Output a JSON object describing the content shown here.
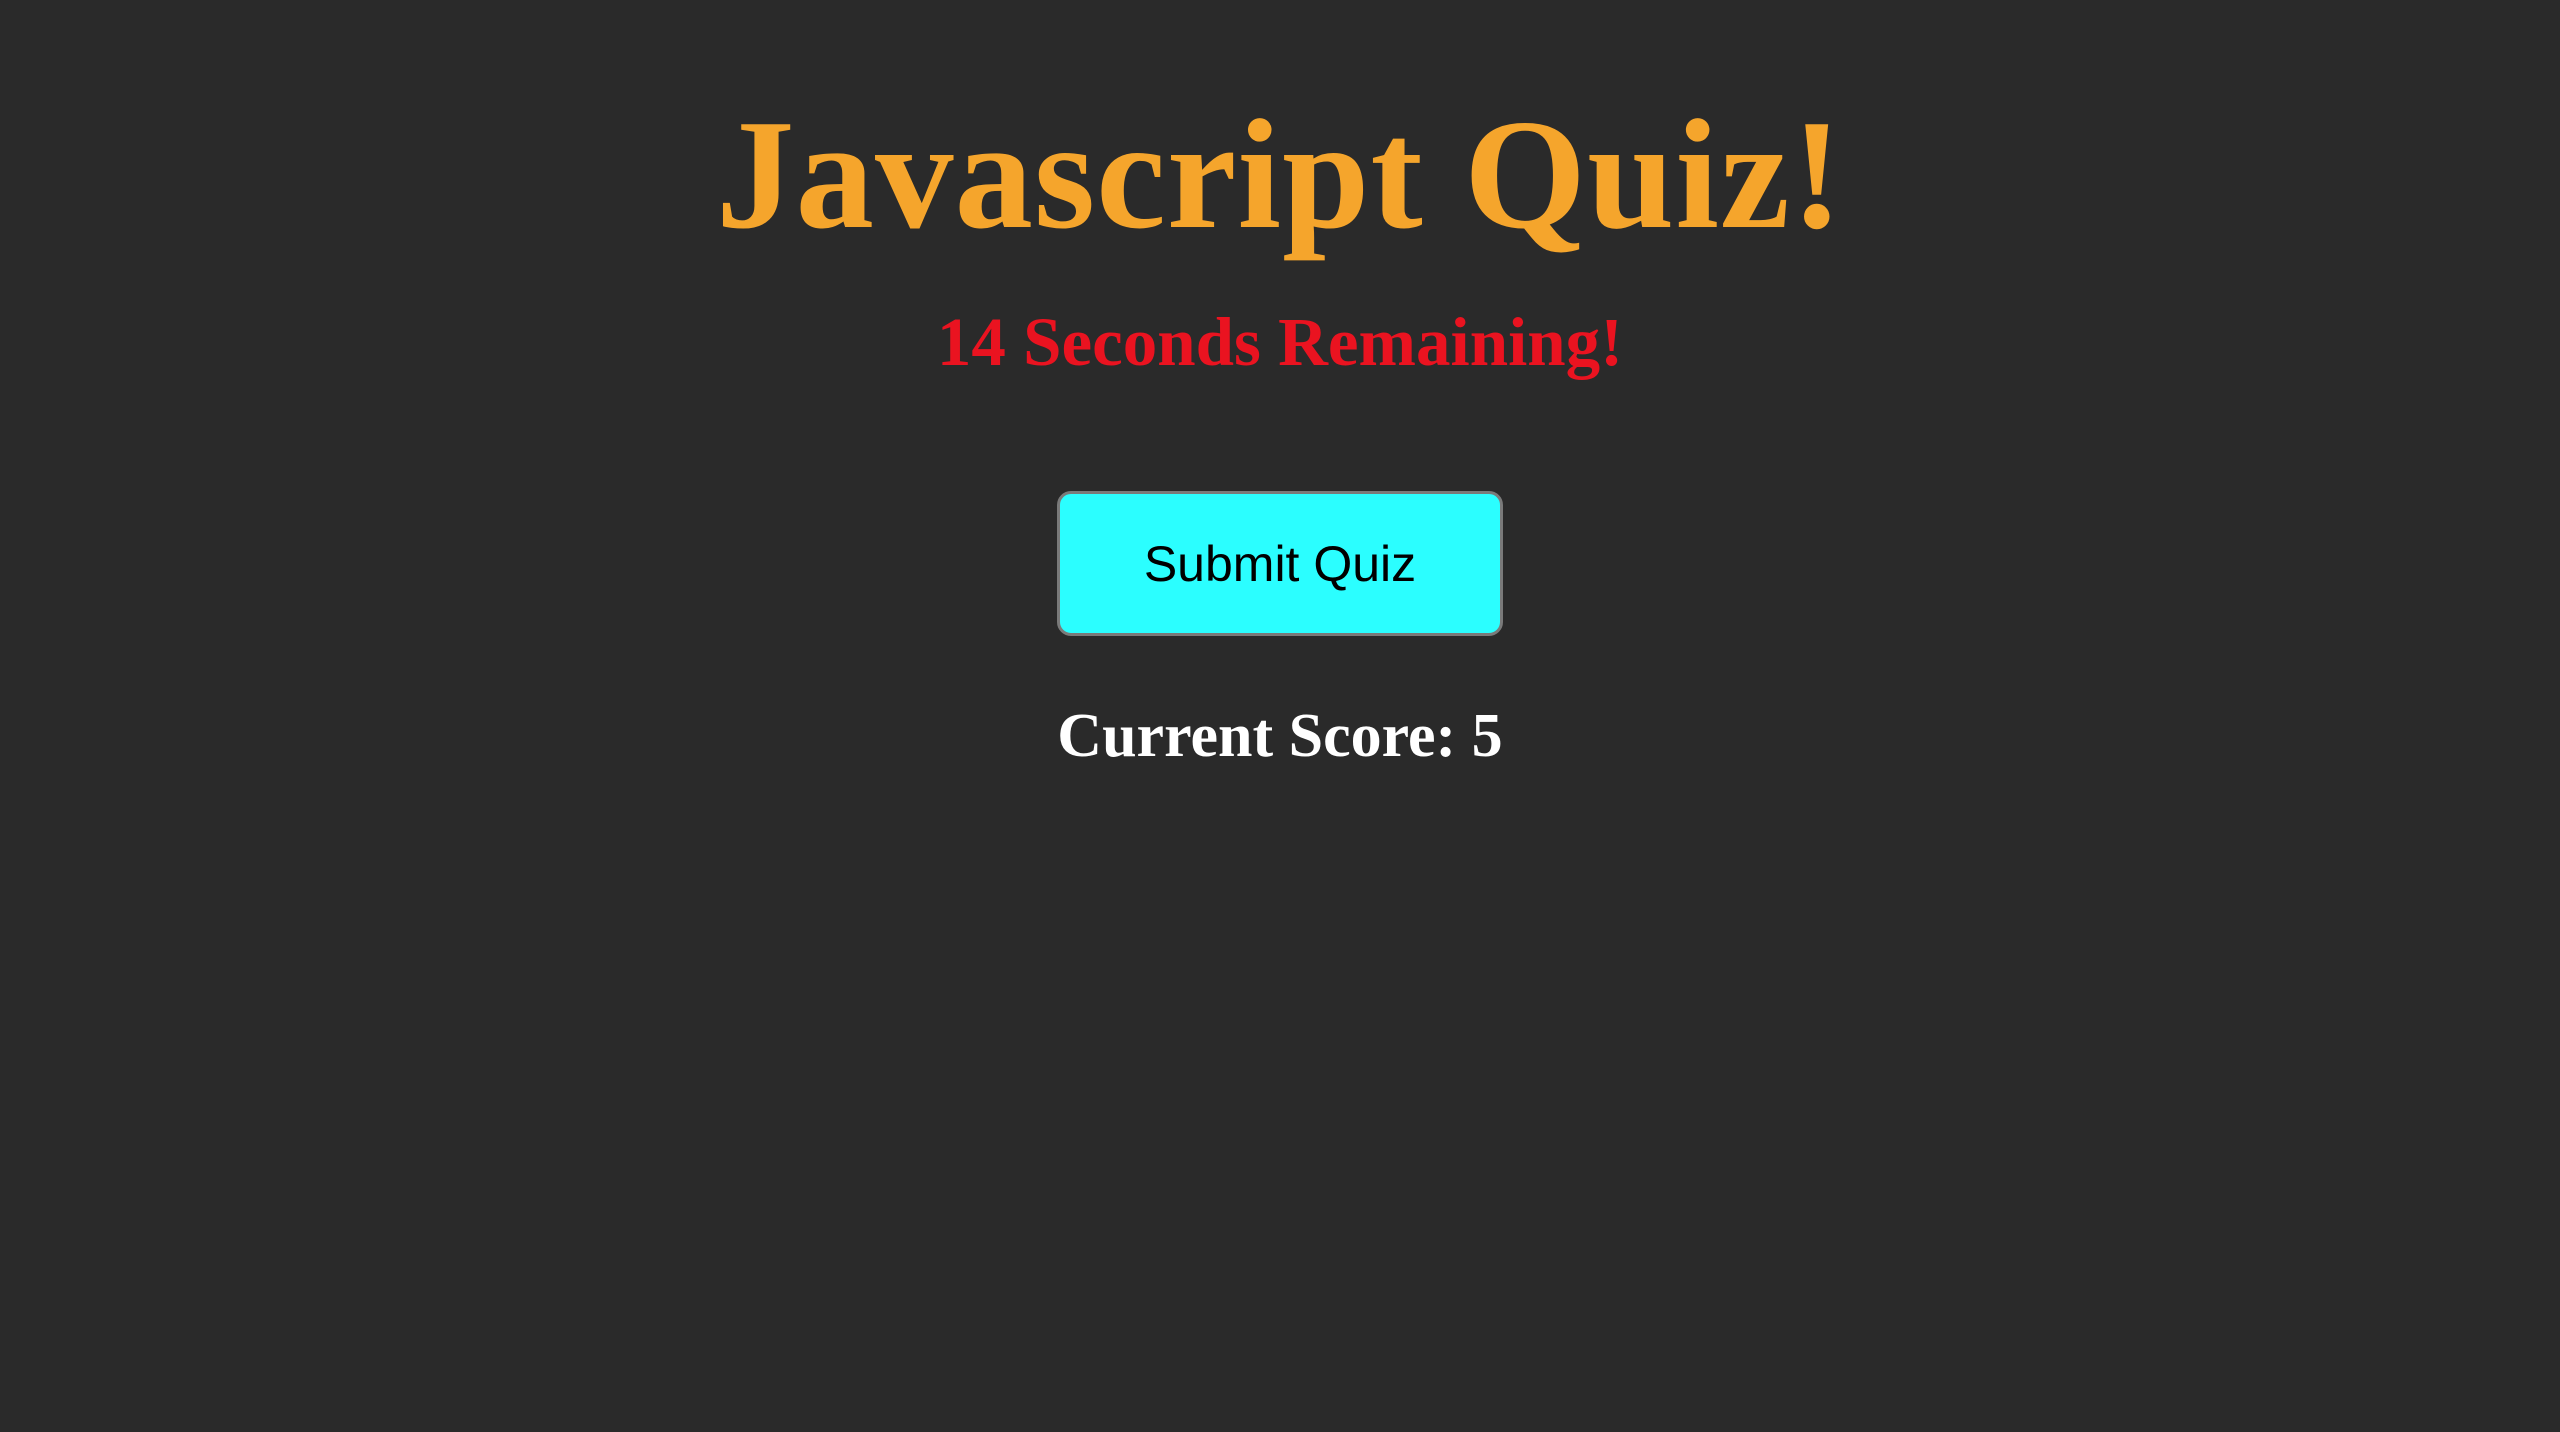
{
  "header": {
    "title": "Javascript Quiz!"
  },
  "timer": {
    "text": "14 Seconds Remaining!"
  },
  "quiz": {
    "submit_label": "Submit Quiz"
  },
  "score": {
    "text": "Current Score: 5"
  },
  "colors": {
    "background": "#2a2a2a",
    "title": "#f5a52c",
    "timer": "#ea1320",
    "button": "#2bfeff",
    "score": "#ffffff"
  }
}
